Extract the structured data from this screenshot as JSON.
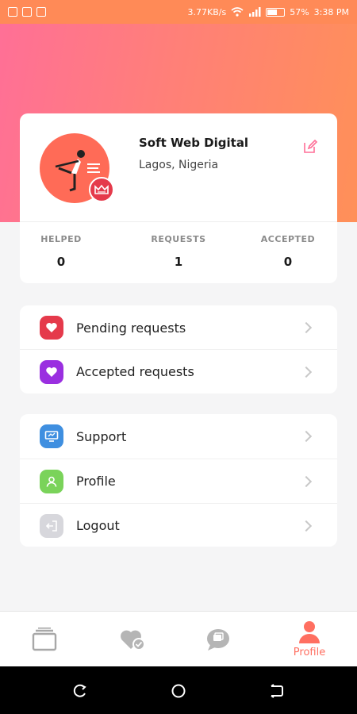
{
  "status_bar": {
    "speed": "3.77KB/s",
    "battery": "57%",
    "time": "3:38 PM"
  },
  "profile": {
    "name": "Soft Web Digital",
    "location": "Lagos, Nigeria"
  },
  "stats": [
    {
      "label": "HELPED",
      "value": "0"
    },
    {
      "label": "REQUESTS",
      "value": "1"
    },
    {
      "label": "ACCEPTED",
      "value": "0"
    }
  ],
  "requests_menu": [
    {
      "label": "Pending requests",
      "icon": "heart-icon",
      "color": "#e53a4b"
    },
    {
      "label": "Accepted requests",
      "icon": "heart-icon",
      "color": "#9a2fe0"
    }
  ],
  "account_menu": [
    {
      "label": "Support",
      "icon": "monitor-icon",
      "color": "#3f8fe0"
    },
    {
      "label": "Profile",
      "icon": "user-icon",
      "color": "#7ad35a"
    },
    {
      "label": "Logout",
      "icon": "logout-icon",
      "color": "#d7d7dc"
    }
  ],
  "bottom_nav": {
    "active_label": "Profile",
    "active_color": "#ff6f61",
    "items": [
      "cards-icon",
      "heart-check-icon",
      "chat-icon",
      "user-icon"
    ]
  }
}
